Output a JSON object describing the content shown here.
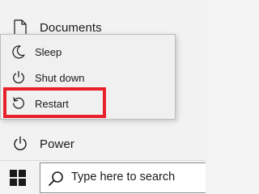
{
  "start_menu": {
    "documents_label": "Documents",
    "power_label": "Power",
    "icons": {
      "documents": "document-icon",
      "power": "power-icon"
    }
  },
  "power_flyout": {
    "items": [
      {
        "label": "Sleep",
        "icon": "moon-icon"
      },
      {
        "label": "Shut down",
        "icon": "power-icon"
      },
      {
        "label": "Restart",
        "icon": "restart-icon"
      }
    ],
    "highlighted_item": "Restart",
    "highlight_color": "#e8202a"
  },
  "taskbar": {
    "start_icon": "windows-logo-icon",
    "search": {
      "placeholder": "Type here to search",
      "icon": "search-icon"
    }
  }
}
